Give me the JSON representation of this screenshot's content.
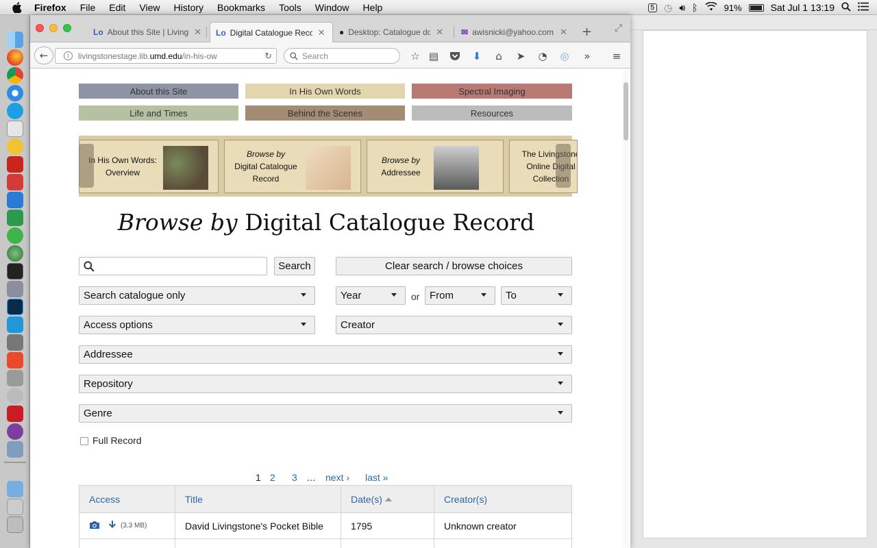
{
  "menubar": {
    "app": "Firefox",
    "items": [
      "File",
      "Edit",
      "View",
      "History",
      "Bookmarks",
      "Tools",
      "Window",
      "Help"
    ],
    "battery": "91%",
    "datetime": "Sat Jul 1  13:19"
  },
  "tabs": [
    {
      "title": "About this Site | Living"
    },
    {
      "title": "Digital Catalogue Reco"
    },
    {
      "title": "Desktop: Catalogue do"
    },
    {
      "title": "awisnicki@yahoo.com"
    }
  ],
  "navbar": {
    "url_pre": "livingstonestage.lib.",
    "url_host": "umd.edu",
    "url_post": "/in-his-ow",
    "search_placeholder": "Search"
  },
  "sitenav": [
    {
      "label": "About this Site",
      "color": "#8f93a6"
    },
    {
      "label": "In His Own Words",
      "color": "#e3d5ad"
    },
    {
      "label": "Spectral Imaging",
      "color": "#b97a74"
    },
    {
      "label": "Life and Times",
      "color": "#b8c0a3"
    },
    {
      "label": "Behind the Scenes",
      "color": "#a38b74"
    },
    {
      "label": "Resources",
      "color": "#bcbcbc"
    }
  ],
  "carousel": [
    {
      "line1": "In His Own Words:",
      "line2": "Overview"
    },
    {
      "pre": "Browse by",
      "line1": "Digital Catalogue",
      "line2": "Record"
    },
    {
      "pre": "Browse by",
      "line1": "Addressee"
    },
    {
      "line1": "The Livingstone",
      "line2": "Online Digital",
      "line3": "Collection"
    }
  ],
  "page": {
    "title_italic": "Browse by",
    "title_rest": " Digital Catalogue Record"
  },
  "controls": {
    "search_button": "Search",
    "clear_button": "Clear search / browse choices",
    "scope_select": "Search catalogue only",
    "year_select": "Year",
    "or_label": "or",
    "from_select": "From",
    "to_select": "To",
    "access_select": "Access options",
    "creator_select": "Creator",
    "addressee_select": "Addressee",
    "repository_select": "Repository",
    "genre_select": "Genre",
    "full_record_label": "Full Record"
  },
  "pagination": {
    "pages": [
      "1",
      "2",
      "3"
    ],
    "ellipsis": "…",
    "next": "next ›",
    "last": "last »"
  },
  "table": {
    "headers": [
      "Access",
      "Title",
      "Date(s)",
      "Creator(s)"
    ],
    "rows": [
      {
        "size": "(3.3 MB)",
        "title": "David Livingstone's Pocket Bible",
        "date": "1795",
        "creator": "Unknown creator"
      }
    ]
  }
}
